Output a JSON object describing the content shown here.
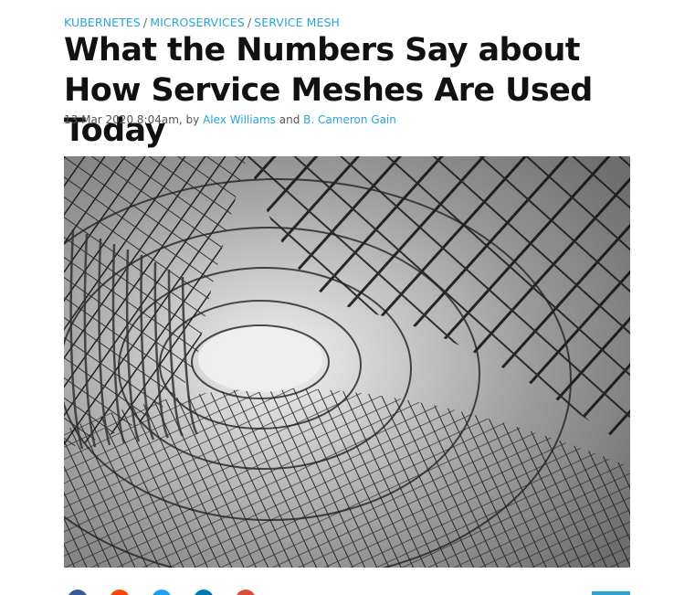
{
  "breadcrumb": {
    "tags": [
      "KUBERNETES",
      "MICROSERVICES",
      "SERVICE MESH"
    ],
    "separator": "/"
  },
  "article": {
    "title": "What the Numbers Say about How Service Meshes Are Used Today",
    "date": "13 Mar 2020 8:04am, by",
    "author_1": "Alex Williams",
    "conjunction": "and",
    "author_2": "B. Cameron Gain"
  },
  "hero_image": {
    "description_icon": "wire-mesh-tunnel-photo"
  },
  "share": {
    "icons": [
      "facebook-icon",
      "reddit-icon",
      "twitter-icon",
      "linkedin-icon",
      "email-icon"
    ],
    "colors": [
      "#3b5998",
      "#ff4500",
      "#1da1f2",
      "#0077b5",
      "#dd4b39"
    ],
    "accent": "#2aa5d6"
  }
}
